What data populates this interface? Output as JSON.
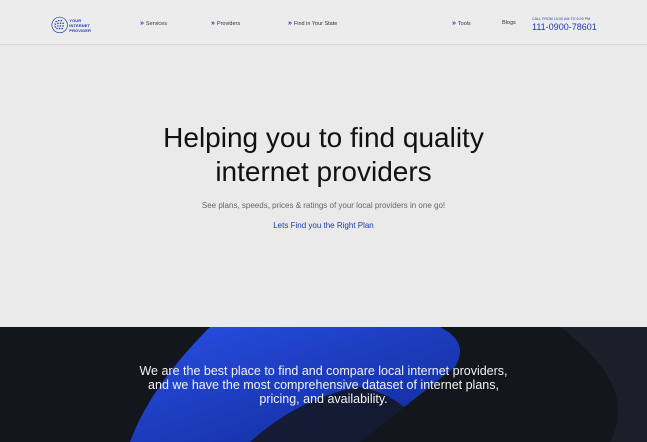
{
  "header": {
    "logo_text": [
      "YOUR",
      "INTERNET",
      "PROVIDER"
    ],
    "nav": [
      "Services",
      "Providers",
      "Find in Your State",
      "Tools"
    ],
    "blogs": "Blogs",
    "call_label": "CALL FROM 10:00 AM TO 6:00 PM",
    "phone": "111-0900-78601"
  },
  "hero": {
    "title_line1": "Helping you to find quality",
    "title_line2": "internet providers",
    "subtitle": "See plans, speeds, prices & ratings of your local providers in one go!",
    "cta": "Lets Find you the Right Plan"
  },
  "banner": {
    "line1": "We are the best place to find and compare local internet providers,",
    "line2": "and we have the most comprehensive dataset of internet plans,",
    "line3": "pricing, and availability."
  },
  "colors": {
    "accent": "#1f3aa8",
    "dark_bg": "#14161d",
    "blue_shape": "#1a3fd6"
  }
}
